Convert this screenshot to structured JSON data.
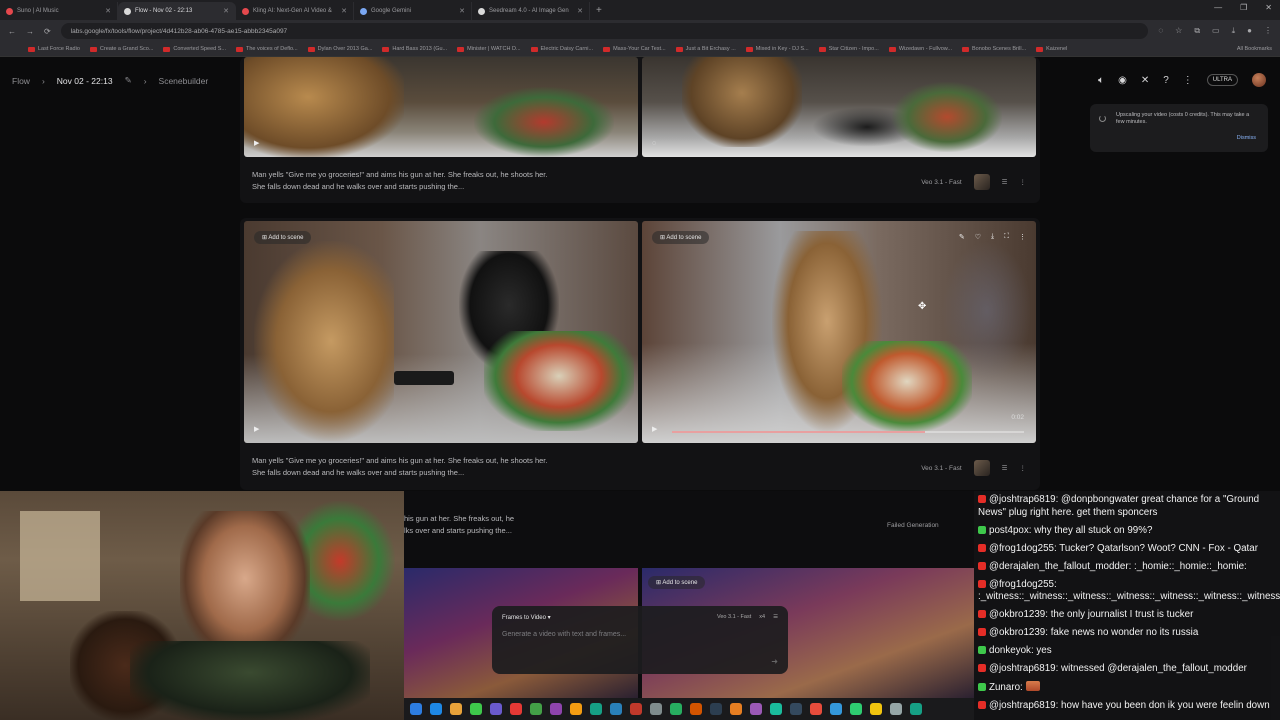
{
  "browser": {
    "tabs": [
      {
        "title": "Suno | AI Music",
        "color": "#e5484d",
        "active": false
      },
      {
        "title": "Flow - Nov 02 - 22:13",
        "color": "#d9d9d9",
        "active": true
      },
      {
        "title": "Kling AI: Next-Gen AI Video &",
        "color": "#e5484d",
        "active": false
      },
      {
        "title": "Google Gemini",
        "color": "#7aa7f2",
        "active": false
      },
      {
        "title": "Seedream 4.0 - AI Image Gen",
        "color": "#d9d9d9",
        "active": false
      }
    ],
    "new_tab": "+",
    "window_controls": [
      "—",
      "❐",
      "✕"
    ],
    "url": "labs.google/fx/tools/flow/project/4d412b28-ab06-4785-ae15-abbb2345a097",
    "bookmarks": [
      "Last Force Radio",
      "Create a Grand Sco...",
      "Converted Speed S...",
      "The voices of Deflo...",
      "Dylan Over 2013 Ga...",
      "Hard Bass 2013 (Gu...",
      "Minister | WATCH D...",
      "Electric Daisy Carni...",
      "Mass-Your Car Test...",
      "Just a Bit Erchasy ...",
      "Mixed in Key - DJ S...",
      "Star Citizen - Impo...",
      "Wizedawn - Fullvow...",
      "Bonobo Scenes Brill...",
      "Kaizenel"
    ],
    "all_bookmarks": "All Bookmarks"
  },
  "header": {
    "app": "Flow",
    "project": "Nov 02 - 22:13",
    "section": "Scenebuilder",
    "plan": "ULTRA"
  },
  "toast": {
    "text": "Upscaling your video (costs 0 credits). This may take a few minutes.",
    "dismiss": "Dismiss"
  },
  "clips": [
    {
      "caption": "Man yells \"Give me yo groceries!\" and aims his gun at her. She freaks out, he shoots her. She falls down dead and he walks over and starts pushing the...",
      "model": "Veo 3.1 - Fast"
    },
    {
      "caption": "Man yells \"Give me yo groceries!\" and aims his gun at her. She freaks out, he shoots her. She falls down dead and he walks over and starts pushing the...",
      "model": "Veo 3.1 - Fast",
      "add_label_a": "Add to scene",
      "add_label_b": "Add to scene",
      "timecode": "0:02",
      "progress": 0.72
    },
    {
      "caption_line1": "his gun at her. She freaks out, he",
      "caption_line2": "lks over and starts pushing the...",
      "status": "Failed Generation"
    }
  ],
  "lower": {
    "add_to_scene": "Add to scene",
    "mode": "Frames to Video",
    "model": "Veo 3.1 - Fast",
    "count": "x4",
    "placeholder": "Generate a video with text and frames..."
  },
  "chat": [
    {
      "badge": "yt",
      "user": "@joshtrap6819:",
      "text": "@donpbongwater great chance for a \"Ground News\" plug right here. get them sponcers"
    },
    {
      "badge": "tw",
      "user": "post4pox:",
      "text": "why they all stuck on 99%?"
    },
    {
      "badge": "yt",
      "user": "@frog1dog255:",
      "text": "Tucker? Qatarlson? Woot? CNN - Fox - Qatar"
    },
    {
      "badge": "yt",
      "user": "@derajalen_the_fallout_modder:",
      "text": ":_homie::_homie::_homie:"
    },
    {
      "badge": "yt",
      "user": "@frog1dog255:",
      "text": ":_witness::_witness::_witness::_witness::_witness::_witness::_witness::_witness::_witness:"
    },
    {
      "badge": "yt",
      "user": "@okbro1239:",
      "text": "the only journalist I trust is tucker"
    },
    {
      "badge": "yt",
      "user": "@okbro1239:",
      "text": "fake news no wonder no its russia"
    },
    {
      "badge": "tw",
      "user": "donkeyok:",
      "text": "yes"
    },
    {
      "badge": "yt",
      "user": "@joshtrap6819:",
      "text": "witnessed @derajalen_the_fallout_modder"
    },
    {
      "badge": "tw",
      "user": "Zunaro:",
      "text": ""
    },
    {
      "badge": "yt",
      "user": "@joshtrap6819:",
      "text": "how have you been don ik you were feelin down"
    }
  ]
}
